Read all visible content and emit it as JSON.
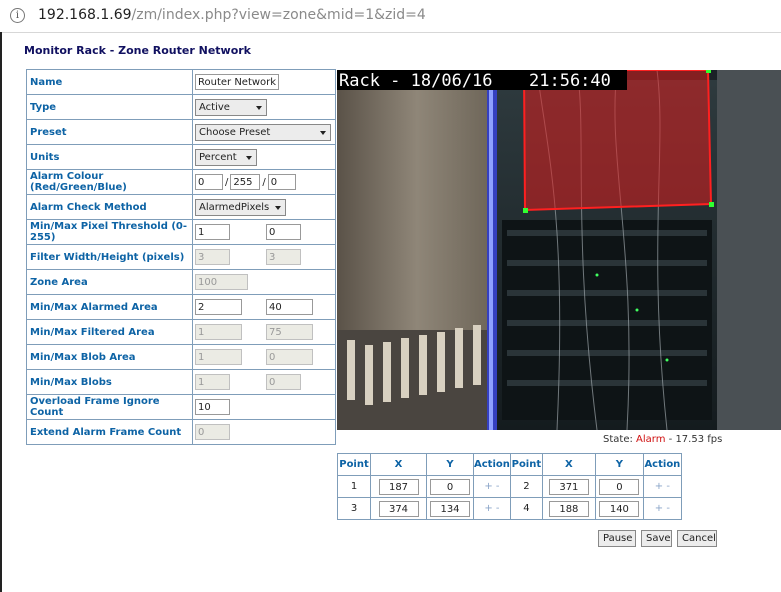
{
  "browser": {
    "url_host": "192.168.1.69",
    "url_path": "/zm/index.php?view=zone&mid=1&zid=4"
  },
  "page": {
    "title": "Monitor Rack - Zone Router Network"
  },
  "form": {
    "name": {
      "label": "Name",
      "value": "Router Network"
    },
    "type": {
      "label": "Type",
      "value": "Active"
    },
    "preset": {
      "label": "Preset",
      "value": "Choose Preset"
    },
    "units": {
      "label": "Units",
      "value": "Percent"
    },
    "alarm_colour": {
      "label": "Alarm Colour (Red/Green/Blue)",
      "r": "0",
      "g": "255",
      "b": "0"
    },
    "alarm_check": {
      "label": "Alarm Check Method",
      "value": "AlarmedPixels"
    },
    "pixel_threshold": {
      "label": "Min/Max Pixel Threshold (0-255)",
      "min": "1",
      "max": "0"
    },
    "filter_size": {
      "label": "Filter Width/Height (pixels)",
      "width": "3",
      "height": "3"
    },
    "zone_area": {
      "label": "Zone Area",
      "value": "100"
    },
    "alarmed_area": {
      "label": "Min/Max Alarmed Area",
      "min": "2",
      "max": "40"
    },
    "filtered_area": {
      "label": "Min/Max Filtered Area",
      "min": "1",
      "max": "75"
    },
    "blob_area": {
      "label": "Min/Max Blob Area",
      "min": "1",
      "max": "0"
    },
    "blobs": {
      "label": "Min/Max Blobs",
      "min": "1",
      "max": "0"
    },
    "overload_ignore": {
      "label": "Overload Frame Ignore Count",
      "value": "10"
    },
    "extend_alarm": {
      "label": "Extend Alarm Frame Count",
      "value": "0"
    }
  },
  "camera": {
    "overlay_label": "Rack - 18/06/16",
    "overlay_time": "21:56:40"
  },
  "status": {
    "prefix": "State:",
    "state": "Alarm",
    "fps": "- 17.53 fps"
  },
  "points_table": {
    "headers": [
      "Point",
      "X",
      "Y",
      "Action",
      "Point",
      "X",
      "Y",
      "Action"
    ],
    "points": [
      {
        "n": "1",
        "x": "187",
        "y": "0"
      },
      {
        "n": "2",
        "x": "371",
        "y": "0"
      },
      {
        "n": "3",
        "x": "374",
        "y": "134"
      },
      {
        "n": "4",
        "x": "188",
        "y": "140"
      }
    ],
    "add_symbol": "+",
    "remove_symbol": "-"
  },
  "buttons": {
    "pause": "Pause",
    "save": "Save",
    "cancel": "Cancel"
  }
}
